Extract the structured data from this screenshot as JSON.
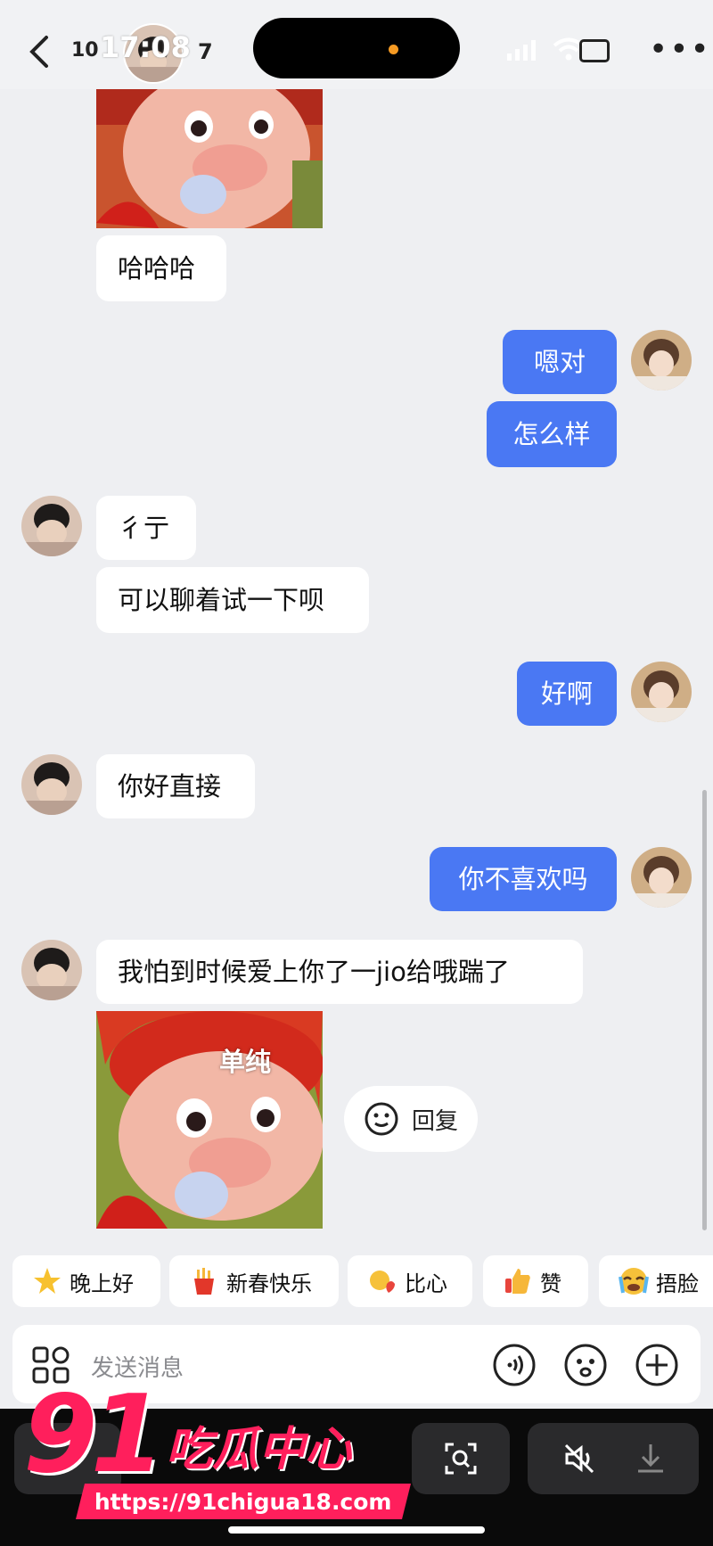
{
  "status": {
    "time": "17:08"
  },
  "header": {
    "unread_count": "10",
    "member_count": "7"
  },
  "messages": {
    "m1": "哈哈哈",
    "m2": "嗯对",
    "m3": "怎么样",
    "m4": "彳亍",
    "m5": "可以聊着试一下呗",
    "m6": "好啊",
    "m7": "你好直接",
    "m8": "你不喜欢吗",
    "m9": "我怕到时候爱上你了一jio给哦踹了"
  },
  "sticker": {
    "caption": "单纯"
  },
  "reply_pill": {
    "label": "回复"
  },
  "quick_replies": [
    "晚上好",
    "新春快乐",
    "比心",
    "赞",
    "捂脸"
  ],
  "input": {
    "placeholder": "发送消息"
  },
  "watermark": {
    "number": "91",
    "name": "吃瓜中心",
    "url": "https://91chigua18.com"
  },
  "colors": {
    "outgoing_bubble": "#4a78f3",
    "background": "#eeeff2",
    "watermark": "#ff1f5c"
  }
}
